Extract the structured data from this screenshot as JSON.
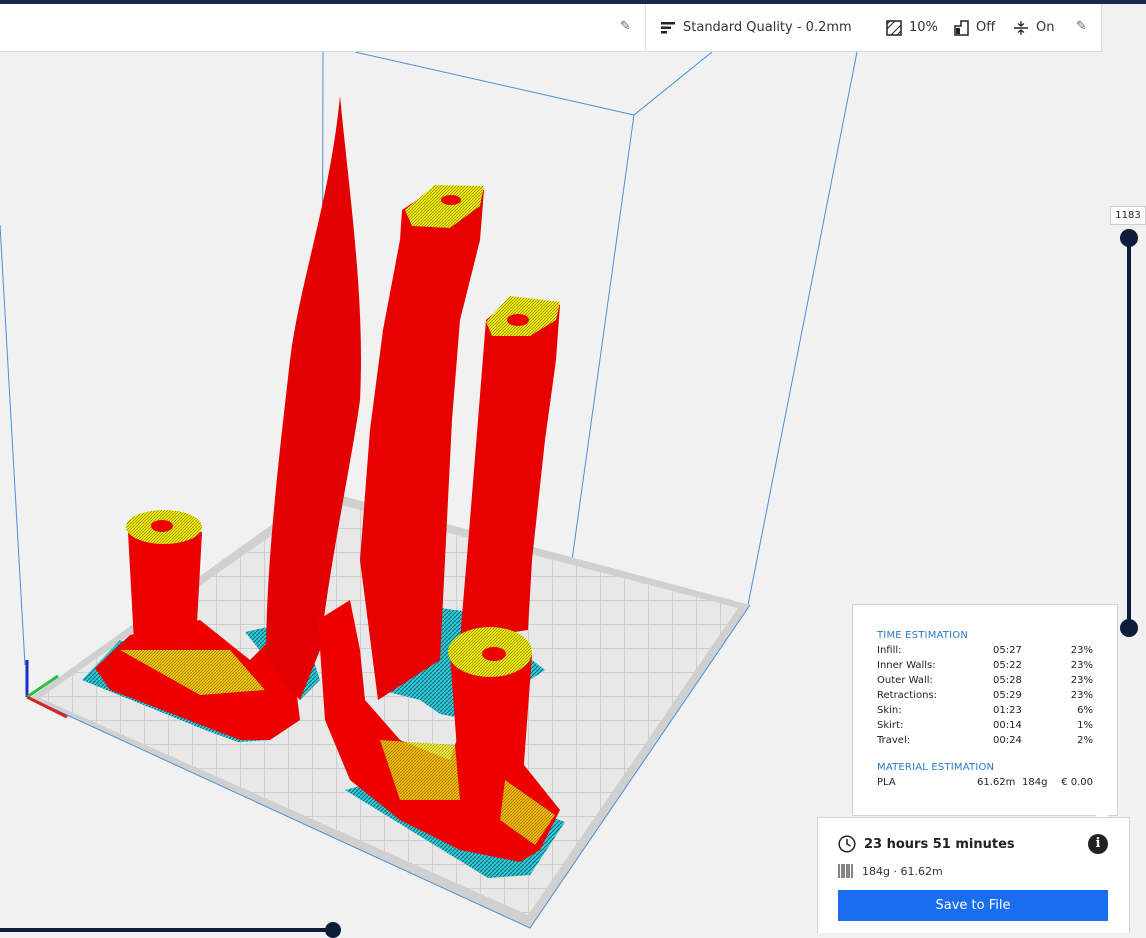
{
  "toolbar": {
    "profile_label": "Standard Quality - 0.2mm",
    "infill_value": "10%",
    "support_value": "Off",
    "adhesion_value": "On"
  },
  "icons": {
    "edit": "pencil-icon",
    "profile": "profile-icon",
    "infill": "infill-icon",
    "support": "support-icon",
    "adhesion": "adhesion-icon",
    "clock": "clock-icon",
    "info": "info-icon",
    "material": "spool-icon"
  },
  "layer_slider": {
    "current_layer": "1183"
  },
  "estimation": {
    "time_title": "TIME ESTIMATION",
    "rows": [
      {
        "label": "Infill:",
        "time": "05:27",
        "pct": "23%"
      },
      {
        "label": "Inner Walls:",
        "time": "05:22",
        "pct": "23%"
      },
      {
        "label": "Outer Wall:",
        "time": "05:28",
        "pct": "23%"
      },
      {
        "label": "Retractions:",
        "time": "05:29",
        "pct": "23%"
      },
      {
        "label": "Skin:",
        "time": "01:23",
        "pct": "6%"
      },
      {
        "label": "Skirt:",
        "time": "00:14",
        "pct": "1%"
      },
      {
        "label": "Travel:",
        "time": "00:24",
        "pct": "2%"
      }
    ],
    "material_title": "MATERIAL ESTIMATION",
    "material": {
      "name": "PLA",
      "length": "61.62m",
      "weight": "184g",
      "cost": "€ 0.00"
    }
  },
  "summary": {
    "print_time": "23 hours 51 minutes",
    "material": "184g · 61.62m",
    "save_label": "Save to File"
  },
  "colors": {
    "accent": "#196ef0",
    "dark": "#0e1c3b",
    "model_red": "#ee0000",
    "model_yellow": "#eded0c",
    "support_cyan": "#3ee0e0"
  }
}
